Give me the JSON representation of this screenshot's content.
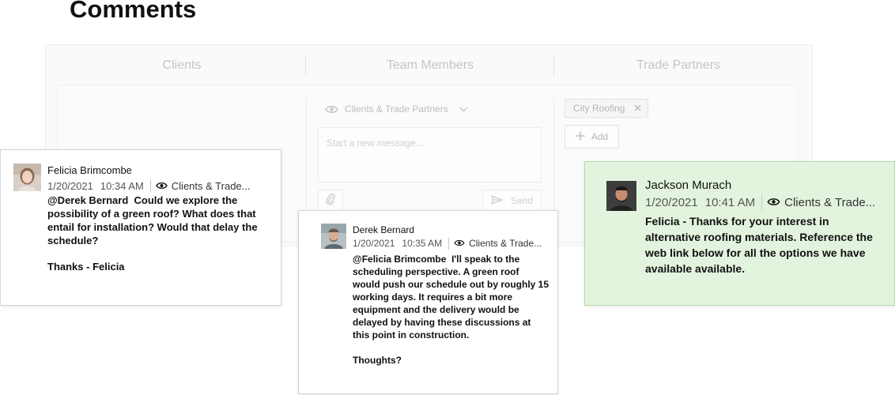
{
  "page": {
    "title": "Comments"
  },
  "tabs": [
    {
      "label": "Clients"
    },
    {
      "label": "Team Members"
    },
    {
      "label": "Trade Partners"
    }
  ],
  "composer": {
    "visibility_label": "Clients & Trade Partners",
    "message_placeholder": "Start a new message...",
    "send_label": "Send",
    "attach_icon": "paperclip-icon"
  },
  "trade_partners": {
    "chips": [
      {
        "label": "City Roofing"
      }
    ],
    "add_label": "Add"
  },
  "comments": [
    {
      "author": "Felicia Brimcombe",
      "date": "1/20/2021",
      "time": "10:34  AM",
      "audience": "Clients & Trade...",
      "mention": "@Derek Bernard",
      "text": "Could we explore the possibility of a green roof? What does that entail for installation? Would that delay the schedule?",
      "signoff": "Thanks - Felicia"
    },
    {
      "author": "Derek Bernard",
      "date": "1/20/2021",
      "time": "10:35 AM",
      "audience": "Clients & Trade...",
      "mention": "@Felicia Brimcombe",
      "text": "I'll speak to the scheduling perspective. A green roof would push our schedule out by roughly 15 working days. It requires a bit more equipment and the delivery would be delayed by having these discussions at this point in construction.",
      "signoff": "Thoughts?"
    },
    {
      "author": "Jackson  Murach",
      "date": "1/20/2021",
      "time": "10:41  AM",
      "audience": "Clients & Trade...",
      "text": "Felicia - Thanks for your interest in alternative roofing materials. Reference the web link below for all the options we have available available.",
      "highlight_color": "#e3f4de"
    }
  ]
}
